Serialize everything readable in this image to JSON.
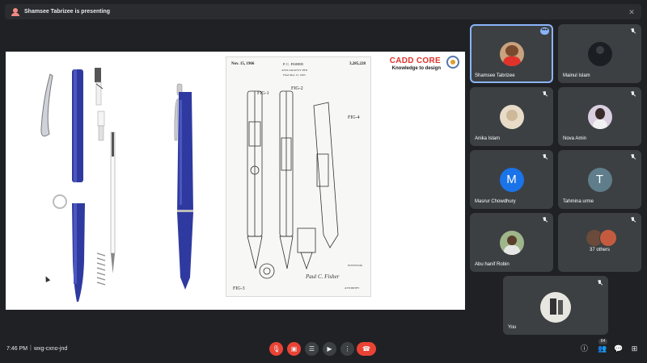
{
  "presenter": {
    "text": "Shamsee Tabrizee is presenting",
    "close_icon": "close-icon"
  },
  "slide": {
    "logo_title": "CADD CORE",
    "logo_tagline": "Knowledge to design",
    "patent": {
      "date": "Nov. 15, 1966",
      "inventor_header": "P. C. FISHER",
      "number": "3,285,228",
      "title": "ANTI-GRAVITY PEN",
      "filed": "Filed May 15, 1965",
      "signature": "Paul C. Fisher",
      "inventor_label": "INVENTOR",
      "attorney_label": "ATTORNEY",
      "fig_labels": [
        "FIG-1",
        "FIG-2",
        "FIG-4",
        "FIG-3"
      ]
    }
  },
  "participants": [
    {
      "name": "Shamsee Tabrizee",
      "avatar": "photo",
      "muted": false,
      "active": true
    },
    {
      "name": "Mainul Islam",
      "avatar": "photo",
      "muted": true
    },
    {
      "name": "Anika Islam",
      "avatar": "photo",
      "muted": true
    },
    {
      "name": "Nova Amin",
      "avatar": "photo",
      "muted": true
    },
    {
      "name": "Masrur Chowdhury",
      "avatar": "M",
      "avatar_color": "#1a73e8",
      "muted": true
    },
    {
      "name": "Tahmina urme",
      "avatar": "T",
      "avatar_color": "#5f7d8a",
      "muted": true
    },
    {
      "name": "Abu hanif Robin",
      "avatar": "photo",
      "muted": true
    },
    {
      "name": "37 others",
      "avatar": "group",
      "muted": true
    },
    {
      "name": "You",
      "avatar": "photo",
      "muted": true
    }
  ],
  "bottom": {
    "time": "7:46 PM",
    "separator": "|",
    "meeting_code": "wxg-cxno-jnd",
    "people_count": "64"
  }
}
